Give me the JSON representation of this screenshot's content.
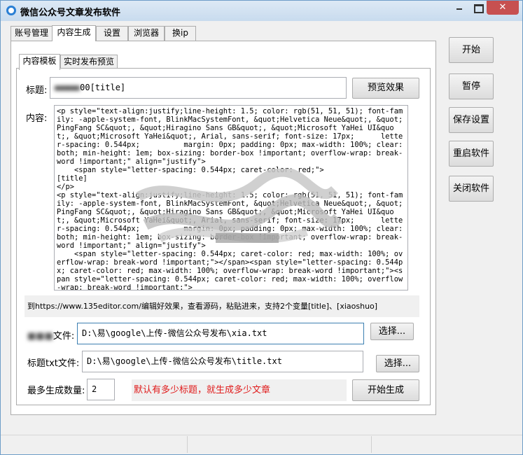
{
  "window": {
    "title": "微信公众号文章发布软件"
  },
  "tabs": [
    {
      "label": "账号管理"
    },
    {
      "label": "内容生成"
    },
    {
      "label": "设置"
    },
    {
      "label": "浏览器"
    },
    {
      "label": "换ip"
    }
  ],
  "inner_tabs": [
    {
      "label": "内容模板"
    },
    {
      "label": "实时发布预览"
    }
  ],
  "form": {
    "title_label": "标题:",
    "title_value": "00[title]",
    "preview_button": "预览效果",
    "content_label": "内容:",
    "content_value": "<p style=\"text-align:justify;line-height: 1.5; color: rgb(51, 51, 51); font-family: -apple-system-font, BlinkMacSystemFont, &quot;Helvetica Neue&quot;, &quot;PingFang SC&quot;, &quot;Hiragino Sans GB&quot;, &quot;Microsoft YaHei UI&quot;, &quot;Microsoft YaHei&quot;, Arial, sans-serif; font-size: 17px;      letter-spacing: 0.544px;          margin: 0px; padding: 0px; max-width: 100%; clear: both; min-height: 1em; box-sizing: border-box !important; overflow-wrap: break-word !important;\" align=\"justify\">\n    <span style=\"letter-spacing: 0.544px; caret-color: red;\">\n[title]\n</p>\n<p style=\"text-align:justify;line-height: 1.5; color: rgb(51, 51, 51); font-family: -apple-system-font, BlinkMacSystemFont, &quot;Helvetica Neue&quot;, &quot;PingFang SC&quot;, &quot;Hiragino Sans GB&quot;, &quot;Microsoft YaHei UI&quot;, &quot;Microsoft YaHei&quot;, Arial, sans-serif; font-size: 17px;      letter-spacing: 0.544px;          margin: 0px; padding: 0px; max-width: 100%; clear: both; min-height: 1em; box-sizing: border-box !important; overflow-wrap: break-word !important;\" align=\"justify\">\n    <span style=\"letter-spacing: 0.544px; caret-color: red; max-width: 100%; overflow-wrap: break-word !important;\"></span><span style=\"letter-spacing: 0.544px; caret-color: red; max-width: 100%; overflow-wrap: break-word !important;\"><span style=\"letter-spacing: 0.544px; caret-color: red; max-width: 100%; overflow-wrap: break-word !important;\">",
    "hint": "到https://www.135editor.com/编辑好效果，查看源码，粘贴进来，支持2个变量[title]、[xiaoshuo]",
    "content_file_label": "文件:",
    "content_file_value": "D:\\易\\google\\上传-微信公众号发布\\xia.txt",
    "choose_button_1": "选择...",
    "title_file_label": "标题txt文件:",
    "title_file_value": "D:\\易\\google\\上传-微信公众号发布\\title.txt",
    "choose_button_2": "选择...",
    "max_count_label": "最多生成数量:",
    "max_count_value": "2",
    "note": "默认有多少标题，就生成多少文章",
    "generate_button": "开始生成"
  },
  "side_buttons": {
    "start": "开始",
    "pause": "暂停",
    "save": "保存设置",
    "restart": "重启软件",
    "close": "关闭软件"
  },
  "colors": {
    "note_text": "#e01b1b",
    "title_icon": "#2a7fd4",
    "close_button": "#c75050"
  }
}
